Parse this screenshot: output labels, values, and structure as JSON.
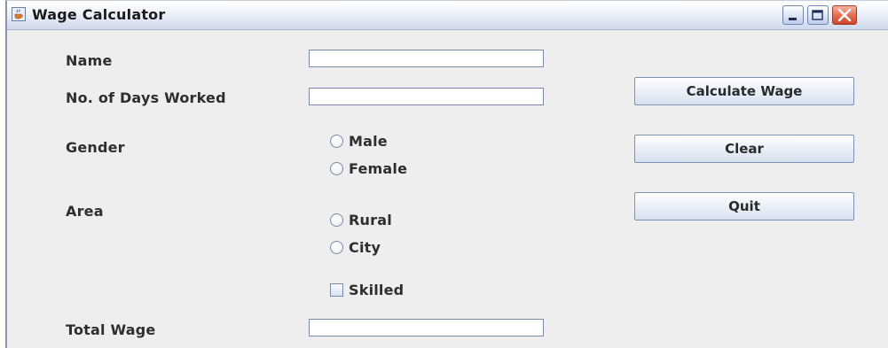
{
  "window": {
    "title": "Wage Calculator",
    "icon": "java-cup-icon",
    "controls": [
      "minimize-icon",
      "maximize-icon",
      "close-icon"
    ]
  },
  "form": {
    "name_label": "Name",
    "name_value": "",
    "days_label": "No. of Days Worked",
    "days_value": "",
    "gender_label": "Gender",
    "gender_options": [
      {
        "label": "Male",
        "selected": false
      },
      {
        "label": "Female",
        "selected": false
      }
    ],
    "area_label": "Area",
    "area_options": [
      {
        "label": "Rural",
        "selected": false
      },
      {
        "label": "City",
        "selected": false
      }
    ],
    "skilled_label": "Skilled",
    "skilled_checked": false,
    "total_label": "Total Wage",
    "total_value": ""
  },
  "buttons": {
    "calculate": "Calculate Wage",
    "clear": "Clear",
    "quit": "Quit"
  }
}
